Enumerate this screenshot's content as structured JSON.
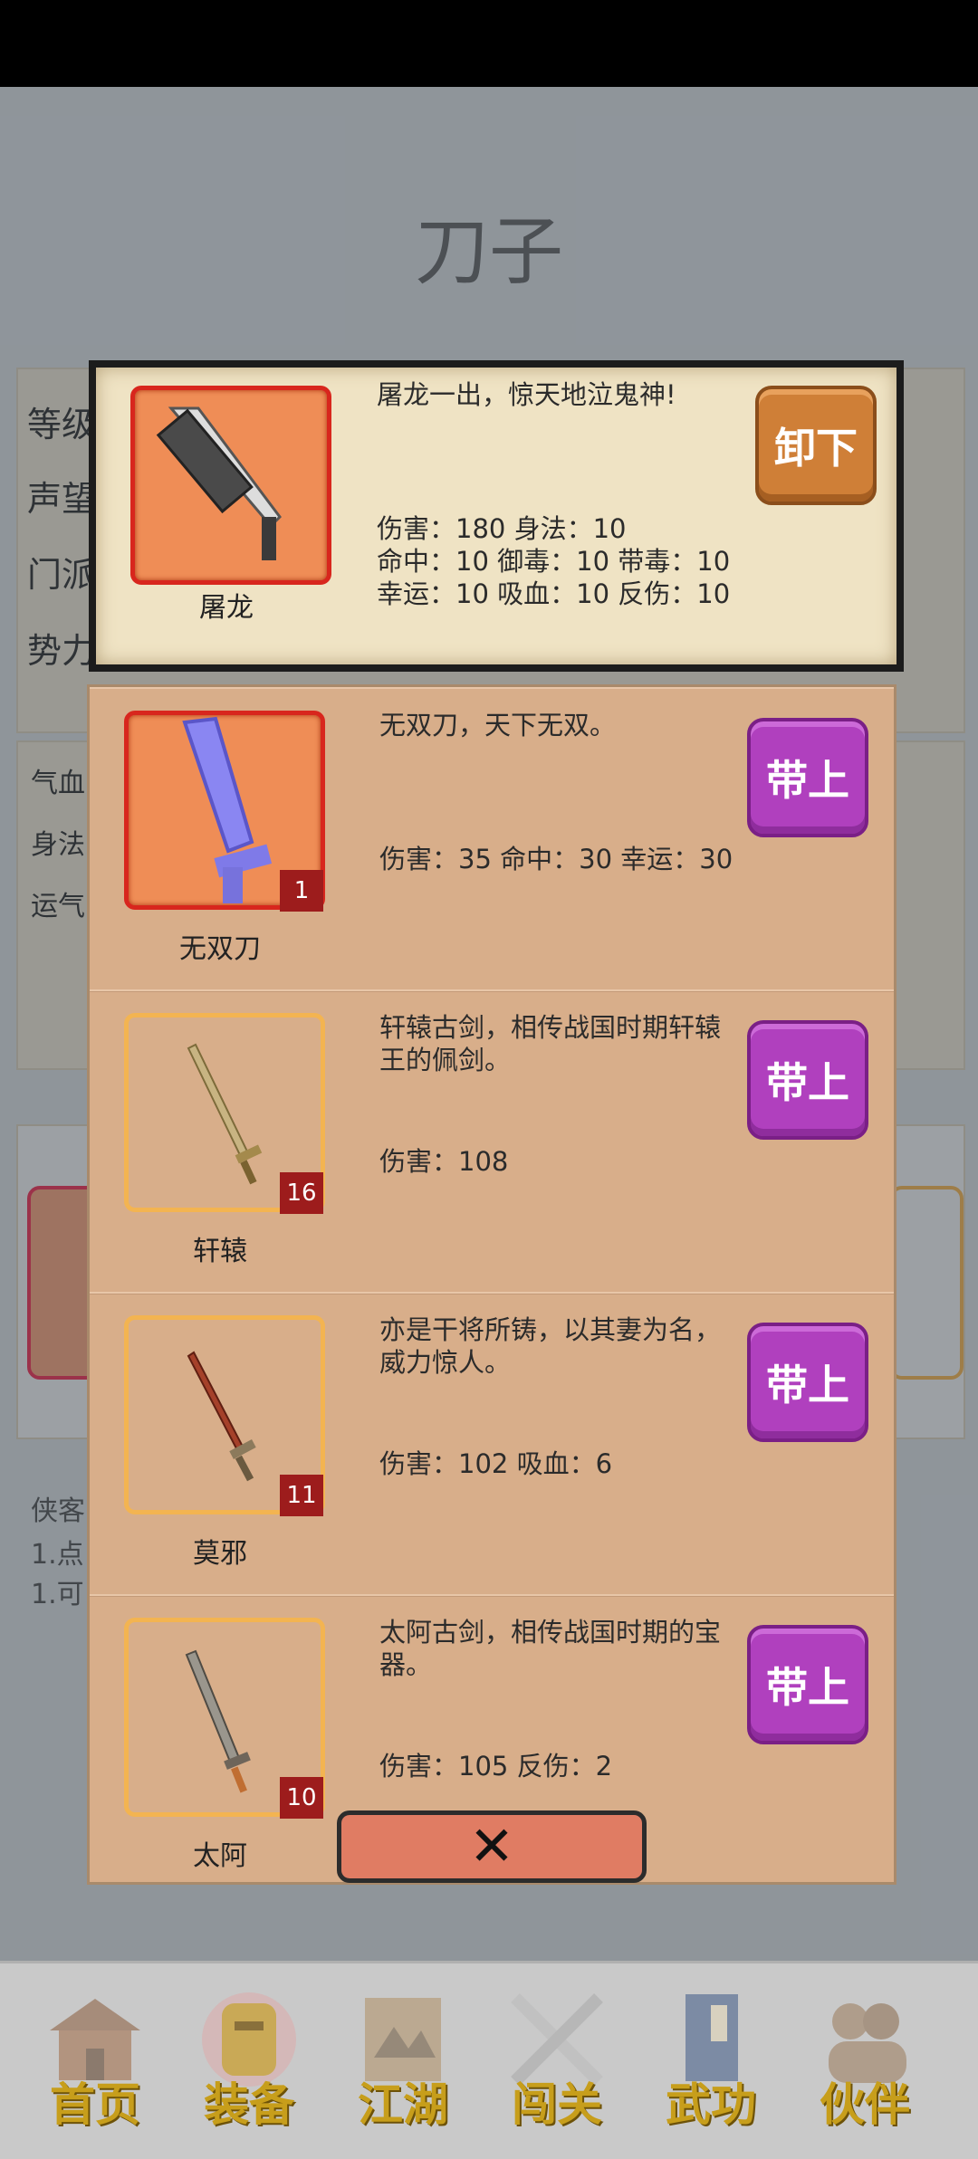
{
  "page": {
    "title": "刀子"
  },
  "background": {
    "rows": [
      "等级",
      "声望",
      "门派",
      "势力：魔教"
    ],
    "stats": [
      "气血",
      "身法",
      "运气"
    ],
    "hero_lines": [
      "侠客",
      "1.点",
      "1.可"
    ]
  },
  "equipped": {
    "name": "屠龙",
    "description": "屠龙一出，惊天地泣鬼神!",
    "stats": [
      "伤害：180 身法：10",
      "命中：10 御毒：10 带毒：10",
      "幸运：10 吸血：10 反伤：10"
    ],
    "button_label": "卸下"
  },
  "inventory": {
    "items": [
      {
        "name": "无双刀",
        "description": "无双刀，天下无双。",
        "stats": "伤害：35 命中：30 幸运：30",
        "count": "1",
        "button_label": "带上"
      },
      {
        "name": "轩辕",
        "description": "轩辕古剑，相传战国时期轩辕王的佩剑。",
        "stats": "伤害：108",
        "count": "16",
        "button_label": "带上"
      },
      {
        "name": "莫邪",
        "description": "亦是干将所铸，以其妻为名，威力惊人。",
        "stats": "伤害：102 吸血：6",
        "count": "11",
        "button_label": "带上"
      },
      {
        "name": "太阿",
        "description": "太阿古剑，相传战国时期的宝器。",
        "stats": "伤害：105 反伤：2",
        "count": "10",
        "button_label": "带上"
      }
    ]
  },
  "close_label": "✕",
  "nav": {
    "items": [
      {
        "label": "首页",
        "icon": "house-icon"
      },
      {
        "label": "装备",
        "icon": "armor-icon"
      },
      {
        "label": "江湖",
        "icon": "map-scroll-icon"
      },
      {
        "label": "闯关",
        "icon": "crossed-swords-icon"
      },
      {
        "label": "武功",
        "icon": "book-icon"
      },
      {
        "label": "伙伴",
        "icon": "partners-icon"
      }
    ],
    "active_index": 1
  },
  "colors": {
    "gold_label": "#c79e1b",
    "purple_button": "#b040be",
    "brown_button": "#cf7f37",
    "rarity_red": "#d8261d",
    "rarity_gold": "#f3b451"
  }
}
